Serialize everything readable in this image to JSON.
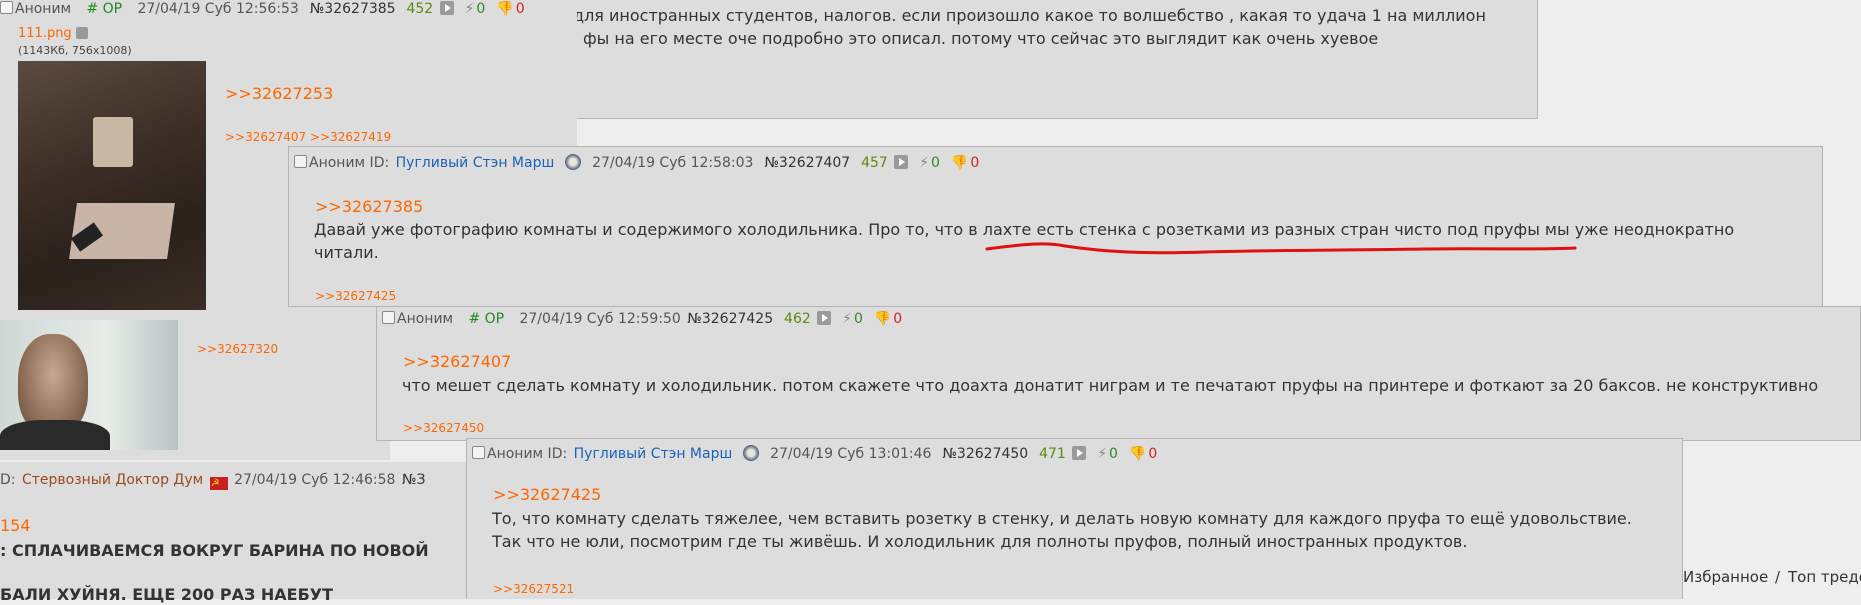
{
  "op_post": {
    "name": "Аноним",
    "trip": "# OP",
    "date": "27/04/19 Суб 12:56:53",
    "num": "№32627385",
    "pc": "452",
    "likes": "0",
    "dislikes": "0",
    "file_name": "111.png",
    "file_info": "(1143Кб, 756x1008)",
    "quote": ">>32627253",
    "replies": ">>32627407 >>32627419",
    "replies2": ">>32627320"
  },
  "bg_post_top": {
    "line1": "для иностранных студентов, налогов. если произошло какое то волшебство , какая то удача 1 на миллион",
    "line2": "фы на его месте оче подробно это описал. потому что сейчас это выглядит как очень хуевое"
  },
  "post_32627407": {
    "name": "Аноним ID:",
    "id": "Пугливый Стэн Марш",
    "date": "27/04/19 Суб 12:58:03",
    "num": "№32627407",
    "pc": "457",
    "likes": "0",
    "dislikes": "0",
    "quote": ">>32627385",
    "line1": "Давай уже фотографию комнаты и содержимого холодильника. Про то, что в лахте есть стенка с розетками из разных стран чисто под пруфы мы уже неоднократно",
    "line2": "читали.",
    "replies": ">>32627425"
  },
  "post_32627425": {
    "name": "Аноним",
    "trip": "# OP",
    "date": "27/04/19 Суб 12:59:50",
    "num": "№32627425",
    "pc": "462",
    "likes": "0",
    "dislikes": "0",
    "quote": ">>32627407",
    "line1": "что мешет сделать комнату и холодильник. потом скажете что доахта донатит ниграм и те печатают пруфы на принтере и фоткают за 20 баксов. не конструктивно",
    "replies": ">>32627450"
  },
  "post_32627450": {
    "name": "Аноним ID:",
    "id": "Пугливый Стэн Марш",
    "date": "27/04/19 Суб 13:01:46",
    "num": "№32627450",
    "pc": "471",
    "likes": "0",
    "dislikes": "0",
    "quote": ">>32627425",
    "line1": "То, что комнату сделать тяжелее, чем вставить розетку в стенку, и делать новую комнату для каждого пруфа то ещё удовольствие.",
    "line2": "Так что не юли, посмотрим где ты живёшь. И холодильник для полноты пруфов, полный иностранных продуктов.",
    "replies": ">>32627521"
  },
  "bg_post_bottom": {
    "id_prefix": "D:",
    "id": "Стервозный Доктор Дум",
    "date": "27/04/19 Суб 12:46:58",
    "num_partial": "№З",
    "quote_partial": "154",
    "line1": ": СПЛАЧИВАЕМСЯ ВОКРУГ БАРИНА ПО НОВОЙ",
    "line2": "БАЛИ ХУЙНЯ. ЕЩЕ 200 РАЗ НАЕБУТ"
  },
  "footer": {
    "favorites": "Избранное",
    "sep": "/",
    "top": "Топ тредо"
  },
  "colors": {
    "post_bg": "#dddddd",
    "page_bg": "#eeeeee",
    "link": "#ff6600",
    "id_blue": "#1b63b5",
    "trip_green": "#228822",
    "underline_red": "#e01010"
  }
}
